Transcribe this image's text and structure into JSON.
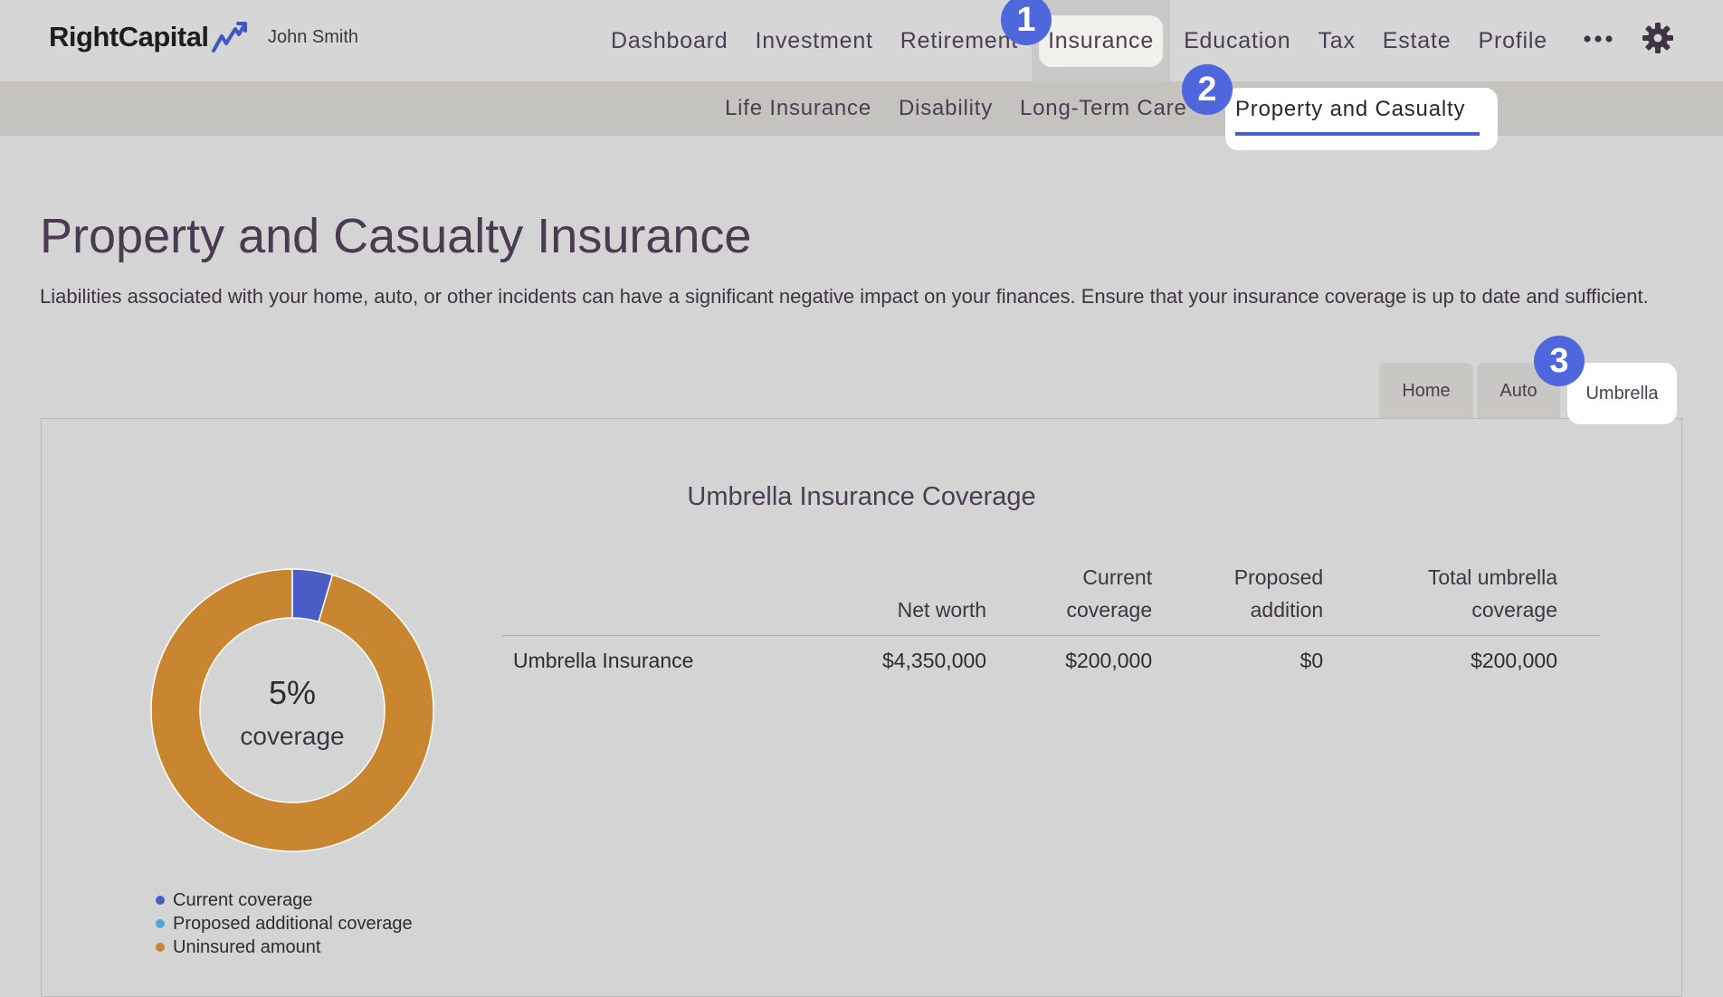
{
  "app": {
    "logo": "RightCapital",
    "user": "John Smith"
  },
  "nav": {
    "items": [
      "Dashboard",
      "Investment",
      "Retirement",
      "Insurance",
      "Education",
      "Tax",
      "Estate",
      "Profile"
    ],
    "active": "Insurance",
    "more_icon": "more-horizontal-icon",
    "settings_icon": "gear-icon"
  },
  "subnav": {
    "items": [
      "Life Insurance",
      "Disability",
      "Long-Term Care"
    ],
    "active": "Property and Casualty"
  },
  "badges": [
    "1",
    "2",
    "3"
  ],
  "page": {
    "title": "Property and Casualty Insurance",
    "description": "Liabilities associated with your home, auto, or other incidents can have a significant negative impact on your finances. Ensure that your insurance coverage is up to date and sufficient."
  },
  "tabs": {
    "items": [
      "Home",
      "Auto",
      "Umbrella"
    ],
    "active": "Umbrella"
  },
  "coverage": {
    "title": "Umbrella Insurance Coverage",
    "center_percent": "5%",
    "center_label": "coverage",
    "legend": [
      {
        "label": "Current coverage",
        "color": "#4a5dc4"
      },
      {
        "label": "Proposed additional coverage",
        "color": "#4ba8d6"
      },
      {
        "label": "Uninsured amount",
        "color": "#c98630"
      }
    ],
    "table": {
      "headers": {
        "net_worth": [
          "Net worth"
        ],
        "current": [
          "Current",
          "coverage"
        ],
        "proposed": [
          "Proposed",
          "addition"
        ],
        "total": [
          "Total umbrella",
          "coverage"
        ]
      },
      "row": {
        "name": "Umbrella Insurance",
        "net_worth": "$4,350,000",
        "current": "$200,000",
        "proposed": "$0",
        "total": "$200,000"
      }
    }
  },
  "chart_data": {
    "type": "pie",
    "categories": [
      "Current coverage",
      "Proposed additional coverage",
      "Uninsured amount"
    ],
    "values": [
      200000,
      0,
      4150000
    ],
    "colors": [
      "#4a5dc4",
      "#4ba8d6",
      "#c98630"
    ],
    "title": "",
    "legend": "bottom-left"
  }
}
